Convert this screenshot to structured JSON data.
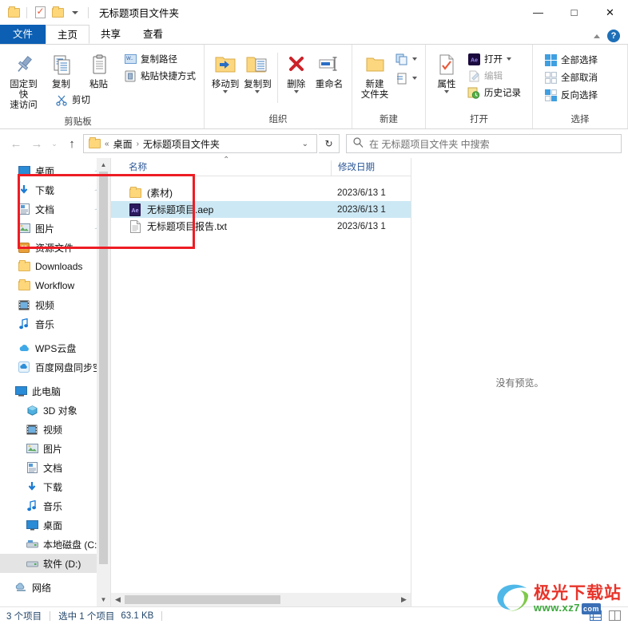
{
  "window": {
    "title": "无标题项目文件夹",
    "minimize_label": "—",
    "maximize_label": "□",
    "close_label": "✕"
  },
  "quick_access_toolbar": {
    "folder_icon": "folder-icon",
    "properties_icon": "properties-icon",
    "new_folder_icon": "new-folder-icon",
    "customize_caret": "chevron-down-icon"
  },
  "tabs": [
    {
      "label": "文件",
      "kind": "file"
    },
    {
      "label": "主页",
      "kind": "active"
    },
    {
      "label": "共享",
      "kind": "normal"
    },
    {
      "label": "查看",
      "kind": "normal"
    }
  ],
  "ribbon": {
    "collapse_icon": "chevron-up-icon",
    "help_icon": "help-icon",
    "help_label": "?",
    "groups": [
      {
        "name": "clipboard",
        "label": "剪贴板",
        "big_buttons": [
          {
            "label": "固定到快\n速访问",
            "line1": "固定到快",
            "line2": "速访问",
            "icon": "pin-icon"
          },
          {
            "label": "复制",
            "line1": "复制",
            "line2": "",
            "icon": "copy-icon"
          },
          {
            "label": "粘贴",
            "line1": "粘贴",
            "line2": "",
            "icon": "paste-icon"
          }
        ],
        "small_buttons": [
          {
            "label": "剪切",
            "icon": "scissors-icon",
            "dim": false
          },
          {
            "label": "复制路径",
            "icon": "copy-path-icon",
            "dim": false
          },
          {
            "label": "粘贴快捷方式",
            "icon": "paste-shortcut-icon",
            "dim": false
          }
        ]
      },
      {
        "name": "organize",
        "label": "组织",
        "big_buttons": [
          {
            "label": "移动到",
            "icon": "move-to-icon",
            "has_caret": true
          },
          {
            "label": "复制到",
            "icon": "copy-to-icon",
            "has_caret": true
          },
          {
            "label": "删除",
            "icon": "delete-icon",
            "has_caret": true
          },
          {
            "label": "重命名",
            "icon": "rename-icon",
            "has_caret": false
          }
        ]
      },
      {
        "name": "new",
        "label": "新建",
        "big_buttons": [
          {
            "line1": "新建",
            "line2": "文件夹",
            "icon": "new-folder-icon"
          }
        ],
        "small_buttons": [
          {
            "label": "",
            "icon": "new-item-icon",
            "has_caret": true
          },
          {
            "label": "",
            "icon": "easy-access-icon",
            "has_caret": true
          }
        ]
      },
      {
        "name": "open",
        "label": "打开",
        "big_buttons": [
          {
            "label": "属性",
            "icon": "properties-icon",
            "has_caret": true
          }
        ],
        "small_buttons": [
          {
            "label": "打开",
            "icon": "ae-app-icon",
            "dim": false,
            "has_caret": true
          },
          {
            "label": "编辑",
            "icon": "edit-icon",
            "dim": true
          },
          {
            "label": "历史记录",
            "icon": "history-icon",
            "dim": false
          }
        ]
      },
      {
        "name": "select",
        "label": "选择",
        "small_buttons": [
          {
            "label": "全部选择",
            "icon": "select-all-icon"
          },
          {
            "label": "全部取消",
            "icon": "select-none-icon"
          },
          {
            "label": "反向选择",
            "icon": "invert-selection-icon"
          }
        ]
      }
    ]
  },
  "navigation": {
    "back_icon": "arrow-left-icon",
    "forward_icon": "arrow-right-icon",
    "recent_icon": "chevron-down-icon",
    "up_icon": "arrow-up-icon",
    "refresh_icon": "refresh-icon",
    "breadcrumb": {
      "folder_icon": "folder-icon",
      "overflow": "«",
      "items": [
        "桌面",
        "无标题项目文件夹"
      ],
      "separator": "›",
      "dropdown_caret": "chevron-down-icon"
    },
    "search": {
      "icon": "search-icon",
      "placeholder": "在 无标题项目文件夹 中搜索",
      "value": ""
    }
  },
  "sidebar": {
    "quick_access": [
      {
        "label": "桌面",
        "icon": "desktop-icon",
        "pinned": true
      },
      {
        "label": "下载",
        "icon": "download-icon",
        "pinned": true
      },
      {
        "label": "文档",
        "icon": "documents-icon",
        "pinned": true
      },
      {
        "label": "图片",
        "icon": "pictures-icon",
        "pinned": true
      },
      {
        "label": "资源文件",
        "icon": "assets-folder-icon",
        "pinned": true
      },
      {
        "label": "Downloads",
        "icon": "folder-icon",
        "pinned": false
      },
      {
        "label": "Workflow",
        "icon": "folder-icon",
        "pinned": false
      },
      {
        "label": "视频",
        "icon": "videos-icon",
        "pinned": false
      },
      {
        "label": "音乐",
        "icon": "music-icon",
        "pinned": false
      }
    ],
    "cloud": [
      {
        "label": "WPS云盘",
        "icon": "wps-cloud-icon"
      },
      {
        "label": "百度网盘同步空间",
        "icon": "baidu-netdisk-icon"
      }
    ],
    "this_pc": {
      "label": "此电脑",
      "icon": "this-pc-icon",
      "children": [
        {
          "label": "3D 对象",
          "icon": "3d-objects-icon"
        },
        {
          "label": "视频",
          "icon": "videos-icon"
        },
        {
          "label": "图片",
          "icon": "pictures-icon"
        },
        {
          "label": "文档",
          "icon": "documents-icon"
        },
        {
          "label": "下载",
          "icon": "download-icon"
        },
        {
          "label": "音乐",
          "icon": "music-icon"
        },
        {
          "label": "桌面",
          "icon": "desktop-icon"
        },
        {
          "label": "本地磁盘 (C:)",
          "icon": "system-drive-icon"
        },
        {
          "label": "软件 (D:)",
          "icon": "drive-icon",
          "selected": true
        }
      ]
    },
    "network": {
      "label": "网络",
      "icon": "network-icon"
    },
    "scrollbar": {
      "up_icon": "chevron-up-icon",
      "down_icon": "chevron-down-icon"
    }
  },
  "filelist": {
    "columns": [
      {
        "label": "名称",
        "sort_icon": "sort-ascending-icon"
      },
      {
        "label": "修改日期"
      }
    ],
    "rows": [
      {
        "name": "(素材)",
        "date": "2023/6/13 1",
        "icon": "folder-icon",
        "selected": false
      },
      {
        "name": "无标题项目.aep",
        "date": "2023/6/13 1",
        "icon": "ae-file-icon",
        "selected": true
      },
      {
        "name": "无标题项目报告.txt",
        "date": "2023/6/13 1",
        "icon": "text-file-icon",
        "selected": false
      }
    ],
    "hscrollbar": {
      "left_icon": "chevron-left-icon",
      "right_icon": "chevron-right-icon"
    }
  },
  "preview_pane": {
    "message": "没有预览。"
  },
  "statusbar": {
    "item_count": "3 个项目",
    "selection": "选中 1 个项目",
    "size": "63.1 KB",
    "details_view_icon": "details-view-icon",
    "large_icons_view_icon": "large-icons-view-icon"
  },
  "annotation": {
    "redbox_color": "#ee1c24"
  },
  "watermark": {
    "title": "极光下载站",
    "url": "www.xz7",
    "badge": "com"
  }
}
